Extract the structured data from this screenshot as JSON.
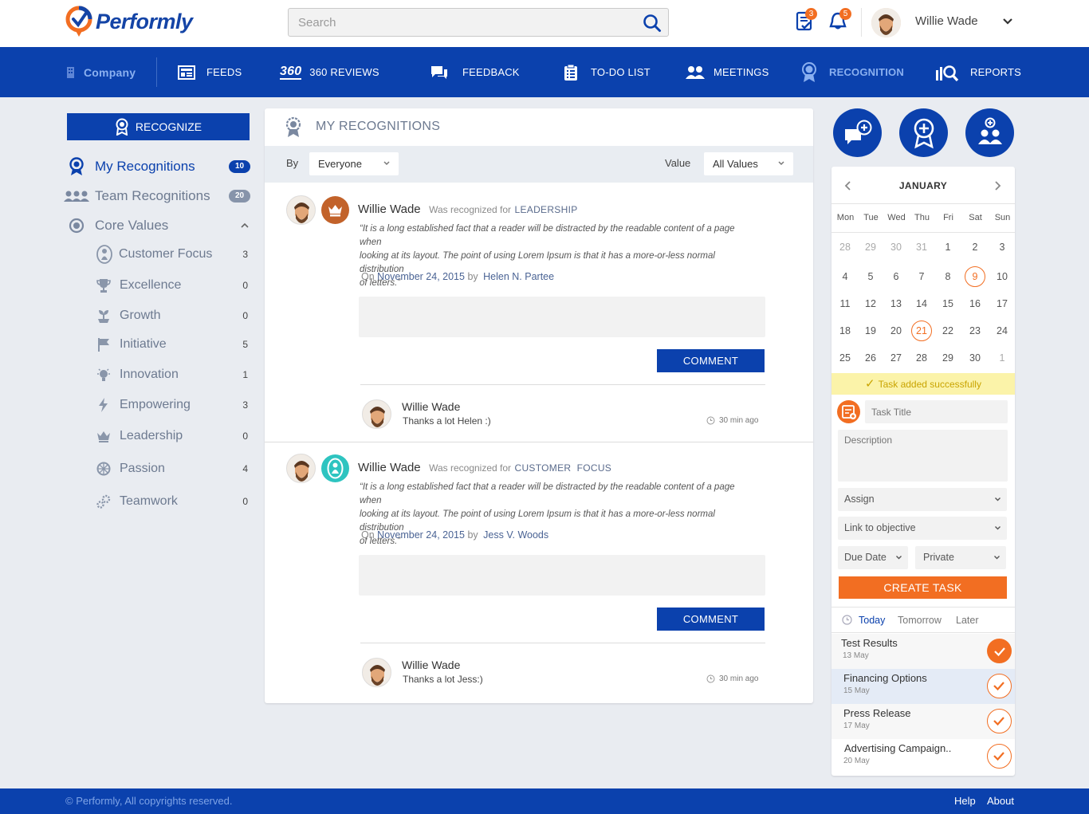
{
  "app": {
    "name": "Performly",
    "brand_color": "#0b41ad",
    "accent_color": "#f26e22"
  },
  "header": {
    "search_placeholder": "Search",
    "tasks_badge": "3",
    "notifications_badge": "5",
    "user_name": "Willie Wade"
  },
  "nav": {
    "company": "Company",
    "items": [
      {
        "label": "FEEDS",
        "icon": "feeds-icon"
      },
      {
        "label": "360 REVIEWS",
        "icon": "reviews-360-icon",
        "icon_text": "360"
      },
      {
        "label": "FEEDBACK",
        "icon": "chat-bubbles-icon"
      },
      {
        "label": "TO-DO LIST",
        "icon": "checklist-icon"
      },
      {
        "label": "MEETINGS",
        "icon": "people-icon"
      },
      {
        "label": "RECOGNITION",
        "icon": "medal-icon",
        "active": true
      },
      {
        "label": "REPORTS",
        "icon": "magnifier-chart-icon"
      }
    ]
  },
  "sidebar": {
    "recognize_label": "RECOGNIZE",
    "my_recognitions": {
      "label": "My Recognitions",
      "count": "10"
    },
    "team_recognitions": {
      "label": "Team Recognitions",
      "count": "20"
    },
    "core_values": {
      "label": "Core Values"
    },
    "values": [
      {
        "label": "Customer Focus",
        "count": "3",
        "icon": "customer-focus-icon"
      },
      {
        "label": "Excellence",
        "count": "0",
        "icon": "trophy-icon"
      },
      {
        "label": "Growth",
        "count": "0",
        "icon": "plant-icon"
      },
      {
        "label": "Initiative",
        "count": "5",
        "icon": "flag-icon"
      },
      {
        "label": "Innovation",
        "count": "1",
        "icon": "bulb-icon"
      },
      {
        "label": "Empowering",
        "count": "3",
        "icon": "lightning-icon"
      },
      {
        "label": "Leadership",
        "count": "0",
        "icon": "crown-icon"
      },
      {
        "label": "Passion",
        "count": "4",
        "icon": "ball-icon"
      },
      {
        "label": "Teamwork",
        "count": "0",
        "icon": "gears-icon"
      }
    ]
  },
  "main": {
    "title": "MY RECOGNITIONS",
    "filter": {
      "by_label": "By",
      "by_value": "Everyone",
      "value_label": "Value",
      "value_value": "All Values"
    },
    "posts": [
      {
        "name": "Willie Wade",
        "recognized_text": "Was recognized for",
        "value": "LEADERSHIP",
        "quote_lines": [
          "“It is a long established fact that a reader will be distracted  by the readable content of a page when",
          "looking at its layout. The point of using Lorem Ipsum is that it has a more-or-less normal distribution",
          "of letters.”"
        ],
        "on_label": "On",
        "date": "November 24, 2015",
        "by_label": "by",
        "author": "Helen N. Partee",
        "comment_label": "COMMENT",
        "reply": {
          "name": "Willie Wade",
          "text": "Thanks a lot Helen :)",
          "time": "30 min ago"
        }
      },
      {
        "name": "Willie Wade",
        "recognized_text": "Was recognized for",
        "value": "CUSTOMER  FOCUS",
        "quote_lines": [
          "“It is a long established fact that a reader will be distracted  by the readable content of a page when",
          "looking at its layout. The point of using Lorem Ipsum is that it has a more-or-less normal distribution",
          "of letters.”"
        ],
        "on_label": "On",
        "date": "November 24, 2015",
        "by_label": "by",
        "author": "Jess V. Woods",
        "comment_label": "COMMENT",
        "reply": {
          "name": "Willie Wade",
          "text": "Thanks a lot Jess:)",
          "time": "30 min ago"
        }
      }
    ]
  },
  "calendar": {
    "month": "JANUARY",
    "weekdays": [
      "Mon",
      "Tue",
      "Wed",
      "Thu",
      "Fri",
      "Sat",
      "Sun"
    ],
    "weeks": [
      [
        "28",
        "29",
        "30",
        "31",
        "1",
        "2",
        "3"
      ],
      [
        "4",
        "5",
        "6",
        "7",
        "8",
        "9",
        "10"
      ],
      [
        "11",
        "12",
        "13",
        "14",
        "15",
        "16",
        "17"
      ],
      [
        "18",
        "19",
        "20",
        "21",
        "22",
        "23",
        "24"
      ],
      [
        "25",
        "26",
        "27",
        "28",
        "29",
        "30",
        "1"
      ]
    ],
    "highlighted_days": [
      "9",
      "21"
    ]
  },
  "task_form": {
    "toast": "Task added successfully",
    "title_placeholder": "Task Title",
    "description_placeholder": "Description",
    "assign": "Assign",
    "link": "Link to objective",
    "due": "Due Date",
    "privacy": "Private",
    "create_label": "CREATE TASK"
  },
  "task_tabs": [
    "Today",
    "Tomorrow",
    "Later"
  ],
  "tasks": [
    {
      "title": "Test Results",
      "date": "13 May",
      "done": true
    },
    {
      "title": "Financing Options",
      "date": "15 May",
      "done": false
    },
    {
      "title": "Press Release",
      "date": "17 May",
      "done": false
    },
    {
      "title": "Advertising Campaign..",
      "date": "20 May",
      "done": false
    }
  ],
  "footer": {
    "copyright": "© Performly, All copyrights reserved.",
    "help": "Help",
    "about": "About"
  }
}
